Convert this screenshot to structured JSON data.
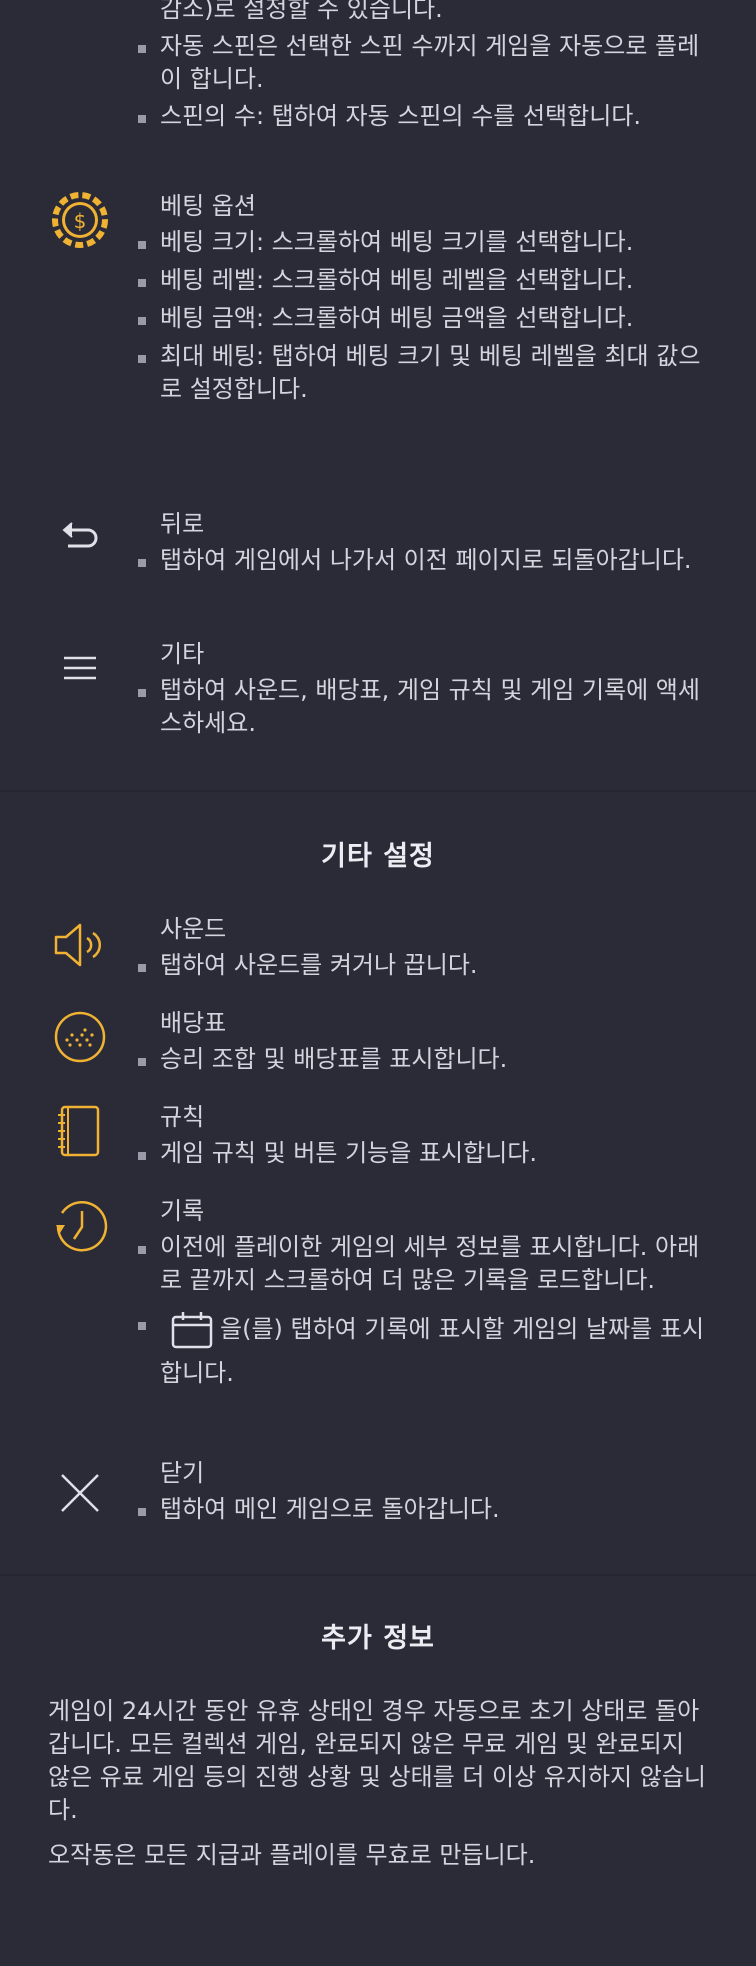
{
  "colors": {
    "accent": "#f0b232",
    "background": "#2b2b38",
    "text": "#d4d4de",
    "divider": "#262630"
  },
  "spin_section": {
    "items": [
      {
        "icon": "none",
        "title": "",
        "bullets": [
          "스핀 속도는 같은 모든 모드(해당 게임에서 일 스핀 시간 감소)로 설정할 수 있습니다.",
          "자동 스핀은 선택한 스핀 수까지 게임을 자동으로 플레이 합니다.",
          "스핀의 수: 탭하여 자동 스핀의 수를 선택합니다."
        ]
      },
      {
        "icon": "coin-dollar-icon",
        "title": "베팅 옵션",
        "bullets": [
          "베팅 크기: 스크롤하여 베팅 크기를 선택합니다.",
          "베팅 레벨: 스크롤하여 베팅 레벨을 선택합니다.",
          "베팅 금액: 스크롤하여 베팅 금액을 선택합니다.",
          "최대 베팅: 탭하여 베팅 크기 및 베팅 레벨을 최대 값으로 설정합니다."
        ]
      },
      {
        "icon": "back-arrow-icon",
        "title": "뒤로",
        "bullets": [
          "탭하여 게임에서 나가서 이전 페이지로 되돌아갑니다."
        ]
      },
      {
        "icon": "menu-icon",
        "title": "기타",
        "bullets": [
          "탭하여 사운드, 배당표, 게임 규칙 및 게임 기록에 액세스하세요."
        ]
      }
    ]
  },
  "other_settings": {
    "title": "기타 설정",
    "items": [
      {
        "icon": "speaker-icon",
        "title": "사운드",
        "bullets": [
          "탭하여 사운드를 켜거나 끕니다."
        ]
      },
      {
        "icon": "paytable-icon",
        "title": "배당표",
        "bullets": [
          "승리 조합 및 배당표를 표시합니다."
        ]
      },
      {
        "icon": "rules-notebook-icon",
        "title": "규칙",
        "bullets": [
          "게임 규칙 및 버튼 기능을 표시합니다."
        ]
      },
      {
        "icon": "history-clock-icon",
        "title": "기록",
        "bullets": [
          "이전에 플레이한 게임의 세부 정보를 표시합니다. 아래로 끝까지 스크롤하여 더 많은 기록을 로드합니다."
        ],
        "calendar_bullet": "을(를) 탭하여 기록에 표시할 게임의 날짜를 표시합니다."
      },
      {
        "icon": "close-icon",
        "title": "닫기",
        "bullets": [
          "탭하여 메인 게임으로 돌아갑니다."
        ]
      }
    ]
  },
  "additional_info": {
    "title": "추가 정보",
    "paragraphs": [
      "게임이 24시간 동안 유휴 상태인 경우 자동으로 초기 상태로 돌아갑니다. 모든 컬렉션 게임, 완료되지 않은 무료 게임 및 완료되지 않은 유료 게임 등의 진행 상황 및 상태를 더 이상 유지하지 않습니다.",
      "오작동은 모든 지급과 플레이를 무효로 만듭니다."
    ]
  }
}
